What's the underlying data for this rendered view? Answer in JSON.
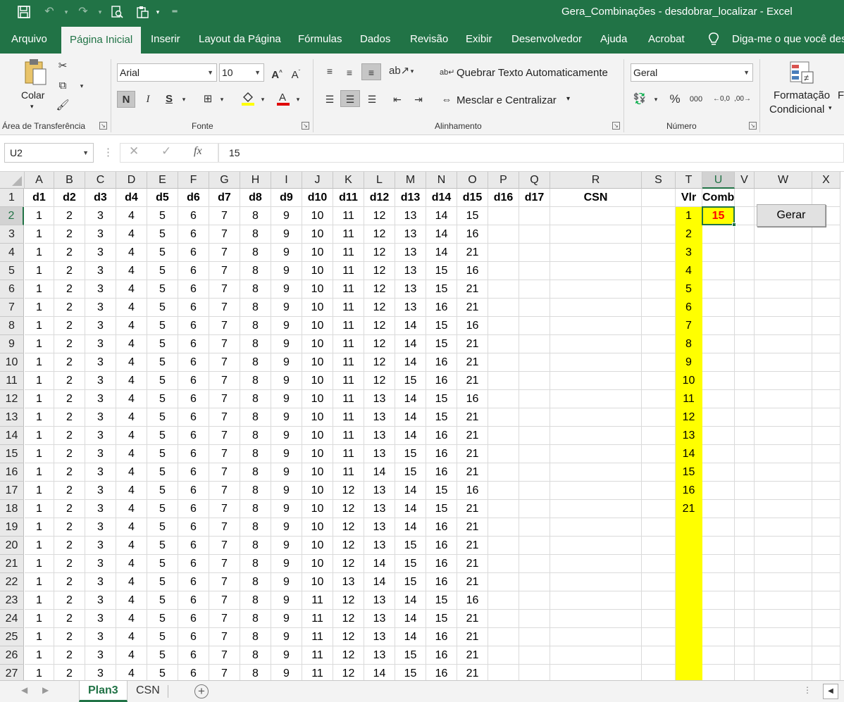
{
  "titlebar": {
    "title": "Gera_Combinações - desdobrar_localizar  -  Excel",
    "quick_access": [
      "save-icon",
      "undo-icon",
      "redo-icon",
      "print-preview-icon",
      "paste-icon",
      "customize-icon"
    ]
  },
  "ribbon_tabs": [
    "Arquivo",
    "Página Inicial",
    "Inserir",
    "Layout da Página",
    "Fórmulas",
    "Dados",
    "Revisão",
    "Exibir",
    "Desenvolvedor",
    "Ajuda",
    "Acrobat",
    "Diga-me o que você des"
  ],
  "ribbon": {
    "clipboard": {
      "paste_label": "Colar",
      "group_label": "Área de Transferência"
    },
    "font": {
      "font_name": "Arial",
      "font_size": "10",
      "bold": "N",
      "italic": "I",
      "underline": "S",
      "group_label": "Fonte"
    },
    "alignment": {
      "wrap_text": "Quebrar Texto Automaticamente",
      "merge_center": "Mesclar e Centralizar",
      "group_label": "Alinhamento"
    },
    "number": {
      "format": "Geral",
      "percent": "%",
      "thousands": "000",
      "group_label": "Número"
    },
    "styles": {
      "conditional_line1": "Formatação",
      "conditional_line2": "Condicional",
      "next_initial": "F"
    }
  },
  "formula_bar": {
    "name_box": "U2",
    "cancel": "✕",
    "enter": "✓",
    "fx": "fx",
    "content": "15"
  },
  "grid": {
    "columns": [
      "A",
      "B",
      "C",
      "D",
      "E",
      "F",
      "G",
      "H",
      "I",
      "J",
      "K",
      "L",
      "M",
      "N",
      "O",
      "P",
      "Q",
      "R",
      "S",
      "T",
      "U",
      "V",
      "W",
      "X"
    ],
    "header_row": [
      "d1",
      "d2",
      "d3",
      "d4",
      "d5",
      "d6",
      "d7",
      "d8",
      "d9",
      "d10",
      "d11",
      "d12",
      "d13",
      "d14",
      "d15",
      "d16",
      "d17",
      "CSN",
      "",
      "Vlr",
      "Comb",
      "",
      "",
      ""
    ],
    "data_rows": [
      [
        1,
        2,
        3,
        4,
        5,
        6,
        7,
        8,
        9,
        10,
        11,
        12,
        13,
        14,
        15
      ],
      [
        1,
        2,
        3,
        4,
        5,
        6,
        7,
        8,
        9,
        10,
        11,
        12,
        13,
        14,
        16
      ],
      [
        1,
        2,
        3,
        4,
        5,
        6,
        7,
        8,
        9,
        10,
        11,
        12,
        13,
        14,
        21
      ],
      [
        1,
        2,
        3,
        4,
        5,
        6,
        7,
        8,
        9,
        10,
        11,
        12,
        13,
        15,
        16
      ],
      [
        1,
        2,
        3,
        4,
        5,
        6,
        7,
        8,
        9,
        10,
        11,
        12,
        13,
        15,
        21
      ],
      [
        1,
        2,
        3,
        4,
        5,
        6,
        7,
        8,
        9,
        10,
        11,
        12,
        13,
        16,
        21
      ],
      [
        1,
        2,
        3,
        4,
        5,
        6,
        7,
        8,
        9,
        10,
        11,
        12,
        14,
        15,
        16
      ],
      [
        1,
        2,
        3,
        4,
        5,
        6,
        7,
        8,
        9,
        10,
        11,
        12,
        14,
        15,
        21
      ],
      [
        1,
        2,
        3,
        4,
        5,
        6,
        7,
        8,
        9,
        10,
        11,
        12,
        14,
        16,
        21
      ],
      [
        1,
        2,
        3,
        4,
        5,
        6,
        7,
        8,
        9,
        10,
        11,
        12,
        15,
        16,
        21
      ],
      [
        1,
        2,
        3,
        4,
        5,
        6,
        7,
        8,
        9,
        10,
        11,
        13,
        14,
        15,
        16
      ],
      [
        1,
        2,
        3,
        4,
        5,
        6,
        7,
        8,
        9,
        10,
        11,
        13,
        14,
        15,
        21
      ],
      [
        1,
        2,
        3,
        4,
        5,
        6,
        7,
        8,
        9,
        10,
        11,
        13,
        14,
        16,
        21
      ],
      [
        1,
        2,
        3,
        4,
        5,
        6,
        7,
        8,
        9,
        10,
        11,
        13,
        15,
        16,
        21
      ],
      [
        1,
        2,
        3,
        4,
        5,
        6,
        7,
        8,
        9,
        10,
        11,
        14,
        15,
        16,
        21
      ],
      [
        1,
        2,
        3,
        4,
        5,
        6,
        7,
        8,
        9,
        10,
        12,
        13,
        14,
        15,
        16
      ],
      [
        1,
        2,
        3,
        4,
        5,
        6,
        7,
        8,
        9,
        10,
        12,
        13,
        14,
        15,
        21
      ],
      [
        1,
        2,
        3,
        4,
        5,
        6,
        7,
        8,
        9,
        10,
        12,
        13,
        14,
        16,
        21
      ],
      [
        1,
        2,
        3,
        4,
        5,
        6,
        7,
        8,
        9,
        10,
        12,
        13,
        15,
        16,
        21
      ],
      [
        1,
        2,
        3,
        4,
        5,
        6,
        7,
        8,
        9,
        10,
        12,
        14,
        15,
        16,
        21
      ],
      [
        1,
        2,
        3,
        4,
        5,
        6,
        7,
        8,
        9,
        10,
        13,
        14,
        15,
        16,
        21
      ],
      [
        1,
        2,
        3,
        4,
        5,
        6,
        7,
        8,
        9,
        11,
        12,
        13,
        14,
        15,
        16
      ],
      [
        1,
        2,
        3,
        4,
        5,
        6,
        7,
        8,
        9,
        11,
        12,
        13,
        14,
        15,
        21
      ],
      [
        1,
        2,
        3,
        4,
        5,
        6,
        7,
        8,
        9,
        11,
        12,
        13,
        14,
        16,
        21
      ],
      [
        1,
        2,
        3,
        4,
        5,
        6,
        7,
        8,
        9,
        11,
        12,
        13,
        15,
        16,
        21
      ],
      [
        1,
        2,
        3,
        4,
        5,
        6,
        7,
        8,
        9,
        11,
        12,
        14,
        15,
        16,
        21
      ]
    ],
    "vlr_values": [
      1,
      2,
      3,
      4,
      5,
      6,
      7,
      8,
      9,
      10,
      11,
      12,
      13,
      14,
      15,
      16,
      21
    ],
    "comb_value": "15",
    "row_numbers": [
      1,
      2,
      3,
      4,
      5,
      6,
      7,
      8,
      9,
      10,
      11,
      12,
      13,
      14,
      15,
      16,
      17,
      18,
      19,
      20,
      21,
      22,
      23,
      24,
      25,
      26,
      27
    ],
    "button_label": "Gerar",
    "highlight_color": "#ffff00",
    "comb_color": "#ff0000"
  },
  "sheet_tabs": {
    "tabs": [
      "Plan3",
      "CSN"
    ],
    "active": "Plan3",
    "add": "+"
  },
  "colors": {
    "excel_green": "#217346"
  }
}
